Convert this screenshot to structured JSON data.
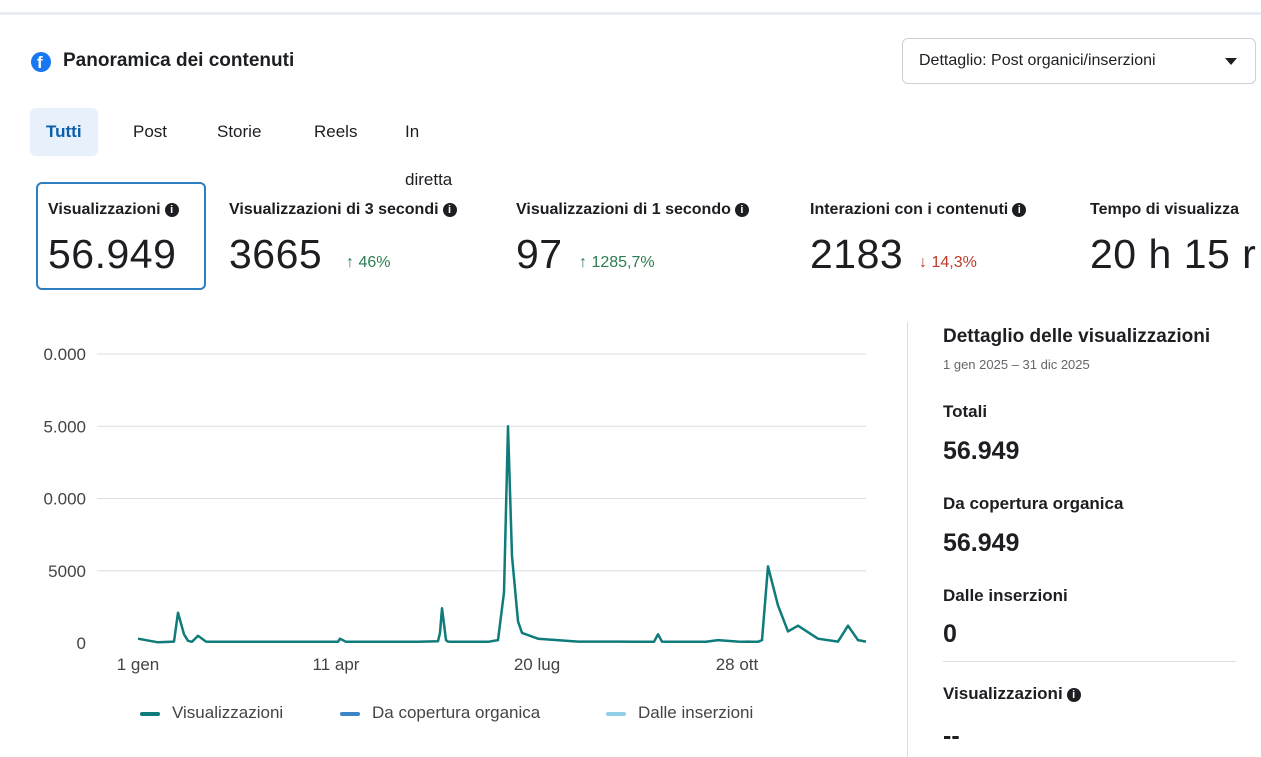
{
  "header": {
    "title": "Panoramica dei contenuti",
    "dropdown_label": "Dettaglio: Post organici/inserzioni"
  },
  "tabs": [
    {
      "label": "Tutti",
      "active": true
    },
    {
      "label": "Post",
      "active": false
    },
    {
      "label": "Storie",
      "active": false
    },
    {
      "label": "Reels",
      "active": false
    },
    {
      "label": "In diretta",
      "active": false
    }
  ],
  "metrics": [
    {
      "label": "Visualizzazioni",
      "value": "56.949",
      "change": "",
      "direction": ""
    },
    {
      "label": "Visualizzazioni di 3 secondi",
      "value": "3665",
      "change": "↑ 46%",
      "direction": "up"
    },
    {
      "label": "Visualizzazioni di 1 secondo",
      "value": "97",
      "change": "↑ 1285,7%",
      "direction": "up"
    },
    {
      "label": "Interazioni con i contenuti",
      "value": "2183",
      "change": "↓ 14,3%",
      "direction": "down"
    },
    {
      "label": "Tempo di visualizza",
      "value": "20 h 15 r",
      "change": "",
      "direction": ""
    }
  ],
  "chart_data": {
    "type": "line",
    "y_tick_labels": [
      "0",
      "5000",
      "0.000",
      "5.000",
      "0.000"
    ],
    "x_tick_labels": [
      "1 gen",
      "11 apr",
      "20 lug",
      "28 ott"
    ],
    "ylim": [
      0,
      20000
    ],
    "grid": true,
    "legend_position": "bottom",
    "series": [
      {
        "name": "Visualizzazioni",
        "color": "#0f7b7b",
        "x": [
          0,
          10,
          18,
          20,
          23,
          25,
          27,
          30,
          34,
          36,
          40,
          50,
          60,
          80,
          100,
          101,
          104,
          120,
          140,
          150,
          151,
          152,
          153,
          154,
          155,
          157,
          160,
          175,
          180,
          183,
          185,
          187,
          190,
          192,
          200,
          220,
          230,
          240,
          250,
          255,
          258,
          260,
          262,
          264,
          266,
          270,
          280,
          284,
          290,
          300,
          303,
          305,
          307,
          310,
          312,
          315,
          320,
          325,
          330,
          340,
          350,
          355,
          360,
          364
        ],
        "y": [
          300,
          50,
          100,
          2100,
          600,
          150,
          80,
          500,
          100,
          80,
          80,
          80,
          80,
          80,
          80,
          300,
          80,
          80,
          80,
          120,
          700,
          2400,
          1300,
          200,
          100,
          80,
          80,
          80,
          200,
          3500,
          15000,
          6000,
          1500,
          700,
          300,
          100,
          100,
          100,
          80,
          80,
          80,
          600,
          100,
          80,
          80,
          80,
          80,
          80,
          200,
          100,
          80,
          100,
          80,
          80,
          200,
          5300,
          2600,
          800,
          1200,
          300,
          100,
          1200,
          200,
          100
        ]
      },
      {
        "name": "Da copertura organica",
        "color": "#3a86c6",
        "x": [],
        "y": []
      },
      {
        "name": "Dalle inserzioni",
        "color": "#8fcfe8",
        "x": [],
        "y": []
      }
    ]
  },
  "sidebar": {
    "title": "Dettaglio delle visualizzazioni",
    "date_range": "1 gen 2025 – 31 dic 2025",
    "items": [
      {
        "label": "Totali",
        "value": "56.949"
      },
      {
        "label": "Da copertura organica",
        "value": "56.949"
      },
      {
        "label": "Dalle inserzioni",
        "value": "0"
      }
    ],
    "bottom_label": "Visualizzazioni",
    "bottom_value": "--"
  },
  "icons": {
    "brand": "facebook-icon",
    "info": "info-icon",
    "dropdown": "caret-down-icon"
  },
  "colors": {
    "brand": "#1877f2",
    "active_tab_bg": "#e7f0fb",
    "active_tab_text": "#0a5fa8",
    "selected_border": "#2d7fc1",
    "up": "#2e7d50",
    "down": "#c0392b"
  }
}
